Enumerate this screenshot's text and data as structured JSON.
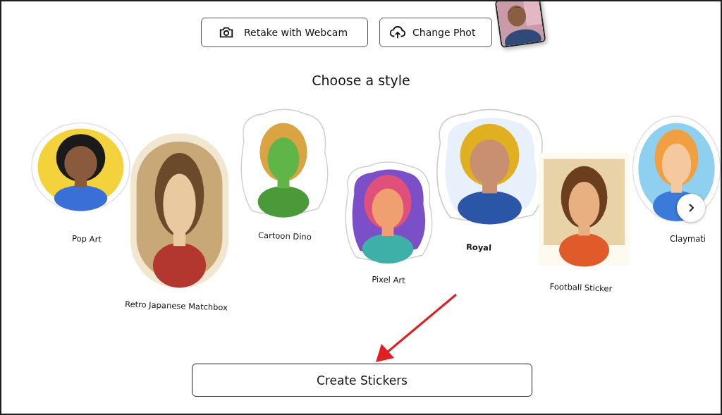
{
  "actions": [
    {
      "kind": "camera",
      "label": "Retake with Webcam"
    },
    {
      "kind": "upload",
      "label": "Change Phot"
    }
  ],
  "title": "Choose a style",
  "styles": [
    {
      "label": "Pop Art",
      "selected": false
    },
    {
      "label": "Retro Japanese Matchbox",
      "selected": false
    },
    {
      "label": "Cartoon Dino",
      "selected": false
    },
    {
      "label": "Pixel Art",
      "selected": false
    },
    {
      "label": "Royal",
      "selected": true
    },
    {
      "label": "Football Sticker",
      "selected": false
    },
    {
      "label": "Claymati",
      "selected": false
    }
  ],
  "primary_button": {
    "label": "Create Stickers"
  }
}
